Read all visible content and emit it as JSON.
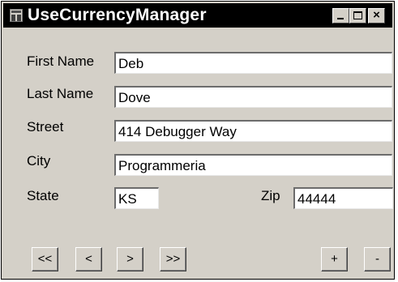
{
  "window": {
    "title": "UseCurrencyManager",
    "min_label": "_",
    "close_label": "×"
  },
  "form": {
    "first_name": {
      "label": "First Name",
      "value": "Deb"
    },
    "last_name": {
      "label": "Last Name",
      "value": "Dove"
    },
    "street": {
      "label": "Street",
      "value": "414 Debugger Way"
    },
    "city": {
      "label": "City",
      "value": "Programmeria"
    },
    "state": {
      "label": "State",
      "value": "KS"
    },
    "zip": {
      "label": "Zip",
      "value": "44444"
    }
  },
  "nav": {
    "first_label": "<<",
    "prev_label": "<",
    "next_label": ">",
    "last_label": ">>",
    "add_label": "+",
    "remove_label": "-"
  },
  "icons": [
    "app-form-icon",
    "minimize-icon",
    "maximize-icon",
    "close-icon"
  ],
  "colors": {
    "window_bg": "#d4d0c8",
    "titlebar_bg": "#000000",
    "title_text": "#ffffff",
    "field_bg": "#ffffff"
  }
}
